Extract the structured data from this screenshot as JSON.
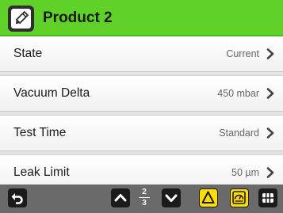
{
  "header": {
    "title": "Product 2",
    "edit_icon": "pencil-icon",
    "accent_color": "#5fd128"
  },
  "settings": [
    {
      "label": "State",
      "value": "Current"
    },
    {
      "label": "Vacuum Delta",
      "value": "450 mbar"
    },
    {
      "label": "Test Time",
      "value": "Standard"
    },
    {
      "label": "Leak Limit",
      "value": "50 µm"
    }
  ],
  "toolbar": {
    "back_icon": "back-arrow-icon",
    "page_up_icon": "chevron-up-icon",
    "page_current": "2",
    "page_total": "3",
    "page_down_icon": "chevron-down-icon",
    "warning_icon": "warning-triangle-icon",
    "gauge_icon": "gauge-icon",
    "menu_icon": "grid-menu-icon",
    "highlight_color": "#ffdd00"
  }
}
